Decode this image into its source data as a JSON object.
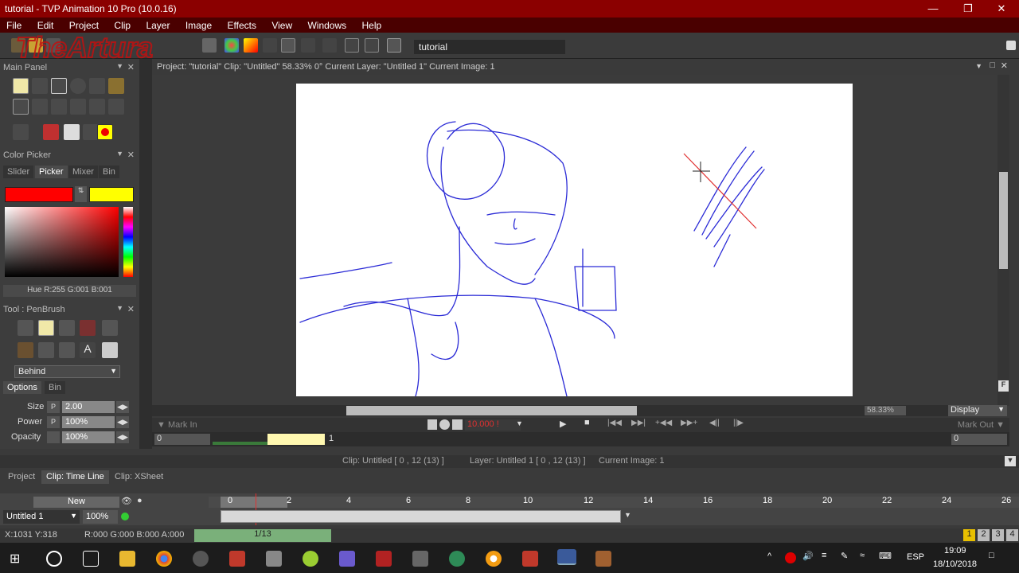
{
  "window": {
    "title": "tutorial - TVP Animation 10 Pro (10.0.16)"
  },
  "menu": [
    "File",
    "Edit",
    "Project",
    "Clip",
    "Layer",
    "Image",
    "Effects",
    "View",
    "Windows",
    "Help"
  ],
  "toolbar": {
    "project_name": "tutorial"
  },
  "watermark": "TheArtura",
  "main_panel": {
    "title": "Main Panel"
  },
  "color_picker": {
    "title": "Color Picker",
    "tabs": [
      "Slider",
      "Picker",
      "Mixer",
      "Bin"
    ],
    "active_tab": "Picker",
    "primary_color": "#ff0000",
    "secondary_color": "#ffff00",
    "readout": "Hue R:255 G:001 B:001"
  },
  "tool_panel": {
    "title": "Tool : PenBrush",
    "mode": "Behind",
    "tabs": [
      "Options",
      "Bin"
    ],
    "size_label": "Size",
    "size_value": "2.00",
    "power_label": "Power",
    "power_value": "100%",
    "opacity_label": "Opacity",
    "opacity_value": "100%"
  },
  "view": {
    "header": "Project: \"tutorial\"  Clip: \"Untitled\"   58.33%   0°   Current Layer: \"Untitled 1\"   Current Image: 1",
    "zoom": "58.33%",
    "display": "Display"
  },
  "playback": {
    "mark_in": "Mark In",
    "mark_out": "Mark Out",
    "fps": "10.000 !",
    "frame_start": "0",
    "frame_end": "0",
    "frame_marker": "1"
  },
  "status": {
    "clip": "Clip: Untitled [ 0 , 12  (13) ]",
    "layer": "Layer: Untitled 1 [ 0 , 12  (13) ]",
    "image": "Current Image: 1"
  },
  "tabs": [
    "Project",
    "Clip: Time Line",
    "Clip: XSheet"
  ],
  "timeline": {
    "new_label": "New",
    "layer_name": "Untitled 1",
    "layer_opacity": "100%",
    "ruler": [
      "0",
      "2",
      "4",
      "6",
      "8",
      "10",
      "12",
      "14",
      "16",
      "18",
      "20",
      "22",
      "24",
      "26"
    ]
  },
  "bottom": {
    "coords": "X:1031  Y:318",
    "rgba": "R:000 G:000 B:000 A:000",
    "frame": "1/13",
    "pages": [
      "1",
      "2",
      "3",
      "4"
    ]
  },
  "taskbar": {
    "lang": "ESP",
    "time": "19:09",
    "date": "18/10/2018"
  },
  "colors": {
    "titlebar": "#8b0000",
    "stroke": "#2b2bd6",
    "accent_red": "#e03030"
  }
}
